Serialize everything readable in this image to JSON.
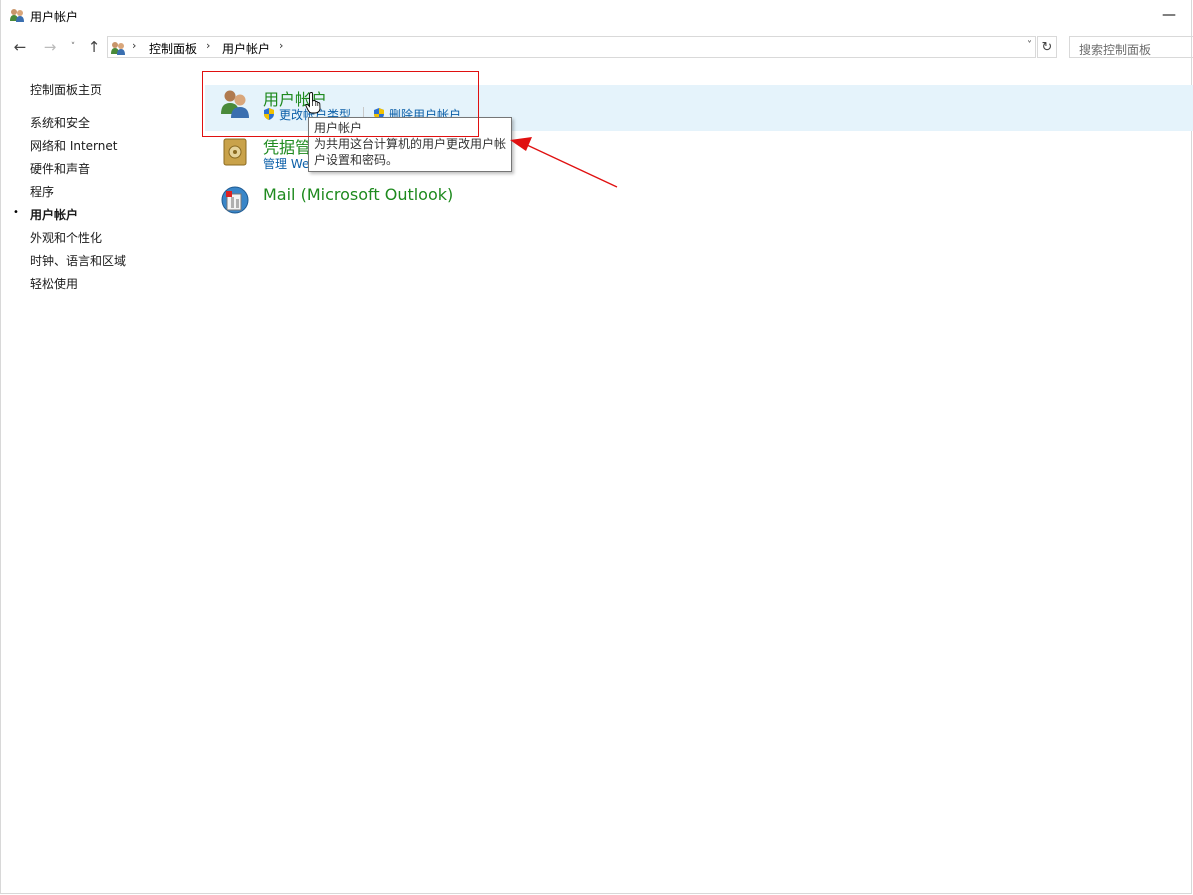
{
  "window": {
    "title": "用户帐户",
    "minimize_glyph": "—"
  },
  "nav": {
    "back_icon": "←",
    "forward_icon": "→",
    "history_icon": "˅",
    "up_icon": "↑",
    "breadcrumbs": [
      "控制面板",
      "用户帐户"
    ],
    "separator": "›",
    "dropdown_icon": "˅",
    "refresh_icon": "↻",
    "search_placeholder": "搜索控制面板"
  },
  "sidebar": {
    "home": "控制面板主页",
    "items": [
      {
        "label": "系统和安全"
      },
      {
        "label": "网络和 Internet"
      },
      {
        "label": "硬件和声音"
      },
      {
        "label": "程序"
      },
      {
        "label": "用户帐户",
        "active": true
      },
      {
        "label": "外观和个性化"
      },
      {
        "label": "时钟、语言和区域"
      },
      {
        "label": "轻松使用"
      }
    ],
    "bullet": "•"
  },
  "main": {
    "categories": [
      {
        "title": "用户帐户",
        "icon": "users-icon",
        "tasks": [
          "更改帐户类型",
          "删除用户帐户"
        ]
      },
      {
        "title": "凭据管",
        "icon": "credential-vault-icon",
        "tasks": [
          "管理 We"
        ]
      },
      {
        "title": "Mail (Microsoft Outlook)",
        "icon": "mail-icon",
        "tasks": []
      }
    ],
    "tooltip": {
      "title": "用户帐户",
      "line1": "为共用这台计算机的用户更改用户帐",
      "line2": "户设置和密码。"
    }
  },
  "colors": {
    "title_green": "#1e8a1e",
    "link_blue": "#0b5fa8",
    "highlight": "#e5f3fb",
    "annotation_red": "#e01010"
  }
}
